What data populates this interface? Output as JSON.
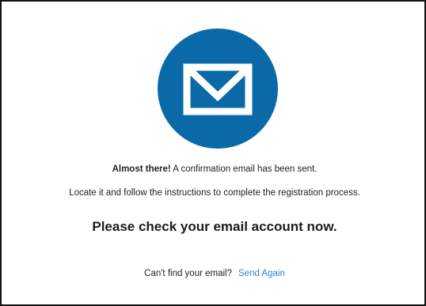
{
  "icon": {
    "name": "envelope-icon",
    "circle_color": "#0a6aa8",
    "glyph_color": "#ffffff"
  },
  "message": {
    "emphasis": "Almost there!",
    "sent_text": " A confirmation email has been sent.",
    "instructions": "Locate it and follow the instructions to complete the registration process.",
    "heading": "Please check your email account now."
  },
  "footer": {
    "prompt": "Can't find your email?",
    "send_again_label": "Send Again",
    "link_color": "#2a86cf"
  }
}
